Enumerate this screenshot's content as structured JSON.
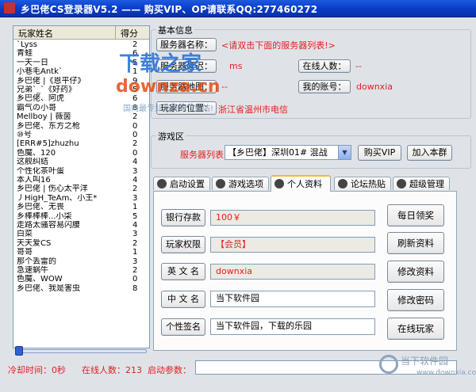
{
  "window": {
    "title": "乡巴佬CS登录器V5.2 —— 购买VIP、OP请联系QQ:277460272"
  },
  "player_list": {
    "header_name": "玩家姓名",
    "header_score": "得分",
    "rows": [
      {
        "name": "`Lyss",
        "score": "2"
      },
      {
        "name": "青蛙",
        "score": "6"
      },
      {
        "name": "一天一日",
        "score": "5"
      },
      {
        "name": "小巷毛Antk`",
        "score": "1"
      },
      {
        "name": "乡巴佬 |《恩平仔》",
        "score": "9"
      },
      {
        "name": "兄弟`_`《好药》",
        "score": "5"
      },
      {
        "name": "乡巴佬、阿虎",
        "score": "6"
      },
      {
        "name": "霸气の小哥",
        "score": "8"
      },
      {
        "name": "Mellboy | 薇茵",
        "score": "2"
      },
      {
        "name": "乡巴佬、东方之枪",
        "score": "0"
      },
      {
        "name": "⑩号",
        "score": "0"
      },
      {
        "name": "[ERR#5]zhuzhu",
        "score": "2"
      },
      {
        "name": "色魔、120",
        "score": "0"
      },
      {
        "name": "这舰纠结",
        "score": "4"
      },
      {
        "name": "个性化茶叶蛋",
        "score": "3"
      },
      {
        "name": "本人叫16",
        "score": "4"
      },
      {
        "name": "乡巴佬 | 伤心太平洋",
        "score": "2"
      },
      {
        "name": "丿HigH_TeAm、小王*",
        "score": "3"
      },
      {
        "name": "乡巴佬、无畏",
        "score": "1"
      },
      {
        "name": "乡棒棒棒...小柒",
        "score": "5"
      },
      {
        "name": "走路太骚容易闪腰",
        "score": "4"
      },
      {
        "name": "白菜",
        "score": "3"
      },
      {
        "name": "天天爱CS",
        "score": "2"
      },
      {
        "name": "哥哥",
        "score": "1"
      },
      {
        "name": "那个丢雷的",
        "score": "3"
      },
      {
        "name": "急速蜗牛",
        "score": "2"
      },
      {
        "name": "色魔、WOW",
        "score": "0"
      },
      {
        "name": "乡巴佬、我是害虫",
        "score": "8"
      }
    ]
  },
  "basic_info": {
    "legend": "基本信息",
    "server_name_label": "服务器名称：",
    "server_name_value": "<请双击下面的服务器列表!>",
    "server_delay_label": "服务器延迟：",
    "server_delay_value": "ms",
    "online_label": "在线人数：",
    "online_value": "--",
    "server_map_label": "服务器地图：",
    "server_map_value": "--",
    "account_label": "我的账号：",
    "account_value": "downxia",
    "location_label": "玩家的位置：",
    "location_value": "浙江省温州市电信"
  },
  "game_area": {
    "legend": "游戏区",
    "server_list_label": "服务器列表：",
    "server_select": "【乡巴佬】深圳01# 混战",
    "buy_vip": "购买VIP",
    "join_group": "加入本群"
  },
  "tabs": [
    {
      "label": "启动设置",
      "icon": "soldier-icon"
    },
    {
      "label": "游戏选项",
      "icon": "soldier-icon"
    },
    {
      "label": "个人资料",
      "icon": "soldier-icon"
    },
    {
      "label": "论坛热贴",
      "icon": "soldier-icon"
    },
    {
      "label": "超级管理",
      "icon": "soldier-icon"
    }
  ],
  "profile": {
    "bank_label": "银行存款",
    "bank_value": "100￥",
    "rights_label": "玩家权限",
    "rights_value": "【会员】",
    "en_name_label": "英 文 名",
    "en_name_value": "downxia",
    "cn_name_label": "中 文 名",
    "cn_name_value": "当下软件园",
    "signature_label": "个性签名",
    "signature_value": "当下软件园，下载的乐园",
    "daily_reward": "每日领奖",
    "refresh": "刷新资料",
    "edit_profile": "修改资料",
    "change_password": "修改密码",
    "online_players": "在线玩家"
  },
  "status": {
    "cooldown": "冷却时间：0秒",
    "online": "在线人数：213",
    "start_params_label": "启动参数："
  },
  "watermark": {
    "brand_cn": "下载之家",
    "brand_url": "downza.cn",
    "slogan": "国内最专业的资源下载站!",
    "corner_cn": "当下软件园",
    "corner_url": "www.downxia.com"
  },
  "colors": {
    "title_bar": "#0a3cc8",
    "accent_red": "#e02020",
    "tab_active": "#f5b83c"
  }
}
